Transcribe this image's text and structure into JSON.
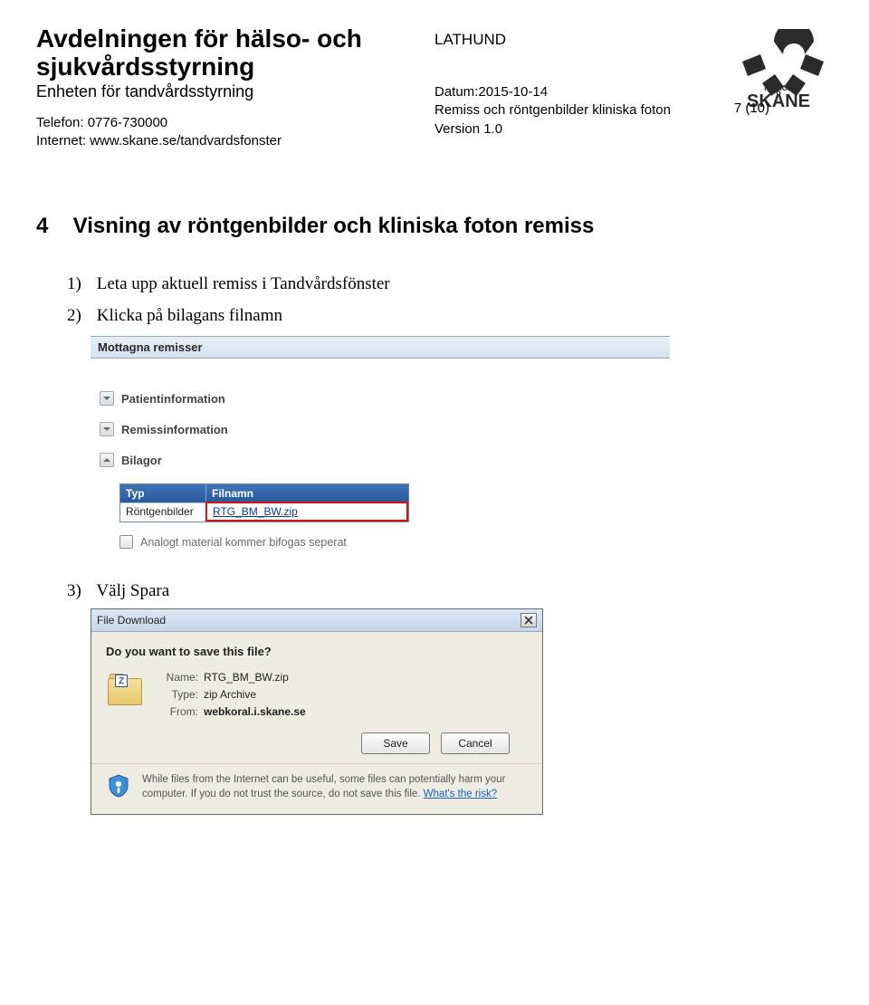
{
  "header": {
    "dept_line1": "Avdelningen för hälso- och",
    "dept_line2": "sjukvårdsstyrning",
    "unit": "Enheten för tandvårdsstyrning",
    "phone": "Telefon: 0776-730000",
    "internet": "Internet: www.skane.se/tandvardsfonster",
    "lathund": "LATHUND",
    "datum": "Datum:2015-10-14",
    "doc_title": "Remiss och röntgenbilder kliniska foton",
    "version": "Version 1.0",
    "page_num": "7 (10)",
    "logo_region": "REGION",
    "logo_skane": "SKÅNE"
  },
  "section": {
    "num": "4",
    "title": "Visning av röntgenbilder och kliniska foton remiss"
  },
  "steps": {
    "s1_num": "1)",
    "s1": "Leta upp aktuell remiss i Tandvårdsfönster",
    "s2_num": "2)",
    "s2": "Klicka på bilagans filnamn",
    "s3_num": "3)",
    "s3": "Välj Spara"
  },
  "shot1": {
    "topbar": "Mottagna remisser",
    "acc1": "Patientinformation",
    "acc2": "Remissinformation",
    "acc3": "Bilagor",
    "col_typ": "Typ",
    "col_fil": "Filnamn",
    "typ_val": "Röntgenbilder",
    "fil_val": "RTG_BM_BW.zip",
    "chk_label": "Analogt material kommer bifogas seperat"
  },
  "shot2": {
    "title": "File Download",
    "question": "Do you want to save this file?",
    "z": "Z",
    "name_lbl": "Name:",
    "name_val": "RTG_BM_BW.zip",
    "type_lbl": "Type:",
    "type_val": "zip Archive",
    "from_lbl": "From:",
    "from_val": "webkoral.i.skane.se",
    "save": "Save",
    "cancel": "Cancel",
    "foot": "While files from the Internet can be useful, some files can potentially harm your computer. If you do not trust the source, do not save this file. ",
    "risk_link": "What's the risk?"
  }
}
